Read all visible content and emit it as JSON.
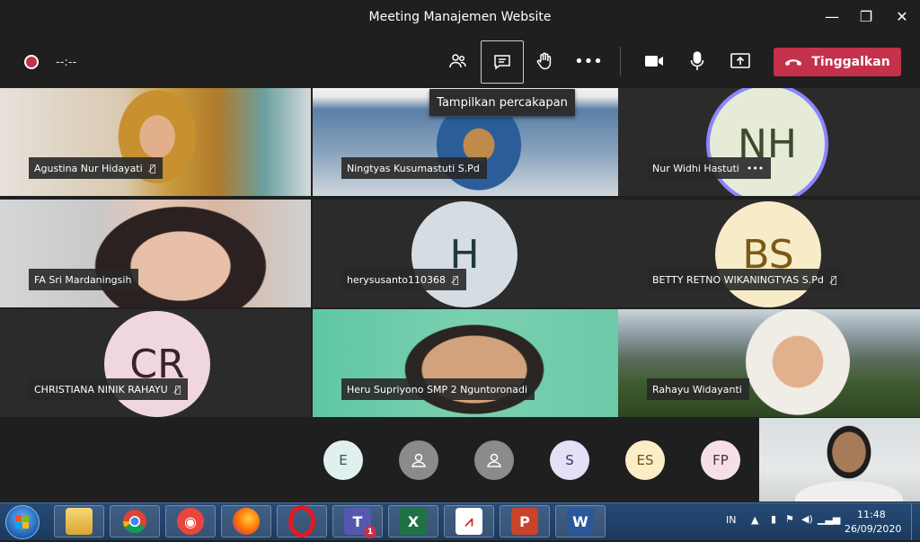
{
  "window": {
    "title": "Meeting Manajemen Website",
    "minimize": "—",
    "maximize": "❐",
    "close": "✕"
  },
  "toolbar": {
    "timer": "--:--",
    "tooltip": "Tampilkan percakapan",
    "leave_label": "Tinggalkan",
    "colors": {
      "leave": "#c4314b",
      "record": "#c4314b"
    }
  },
  "tiles": [
    {
      "name": "Agustina Nur Hidayati",
      "muted": "🎙̸"
    },
    {
      "name": "Ningtyas Kusumastuti S.Pd"
    },
    {
      "name": "Nur Widhi Hastuti",
      "more": "•••",
      "initials": "NH"
    },
    {
      "name": "FA Sri Mardaningsih"
    },
    {
      "name": "herysusanto110368",
      "muted": "🎙̸",
      "initials": "H"
    },
    {
      "name": "BETTY RETNO WIKANINGTYAS S.Pd",
      "muted": "🎙̸",
      "initials": "BS"
    },
    {
      "name": "CHRISTIANA NINIK RAHAYU",
      "muted": "🎙̸",
      "initials": "CR"
    },
    {
      "name": "Heru Supriyono SMP 2 Nguntoronadi"
    },
    {
      "name": "Rahayu Widayanti"
    }
  ],
  "overflow": [
    {
      "initials": "E"
    },
    {
      "initials": ""
    },
    {
      "initials": ""
    },
    {
      "initials": "S"
    },
    {
      "initials": "ES"
    },
    {
      "initials": "FP"
    }
  ],
  "taskbar": {
    "lang": "IN",
    "time": "11:48",
    "date": "26/09/2020",
    "teams_badge": "1",
    "apps": [
      "chrome-icon",
      "gallery-icon",
      "firefox-icon",
      "opera-icon",
      "teams-icon",
      "excel-icon",
      "acrobat-icon",
      "powerpoint-icon",
      "word-icon"
    ]
  }
}
